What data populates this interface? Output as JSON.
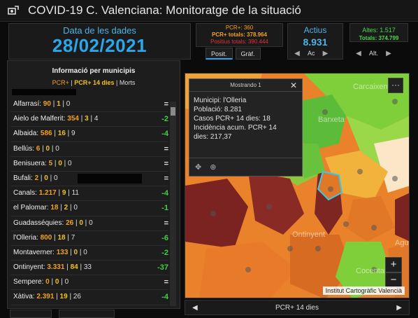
{
  "app": {
    "title": "COVID-19 C. Valenciana: Monitoratge de la situació"
  },
  "date_panel": {
    "label": "Data de les dades",
    "value": "28/02/2021"
  },
  "pcr_panel": {
    "pcr": "PCR+: 360",
    "pcr_totals": "PCR+ totals: 378.964",
    "positius_totals": "Positius totals: 390.444"
  },
  "view_tabs": [
    {
      "label": "Posit."
    },
    {
      "label": "Gràf."
    }
  ],
  "actius": {
    "label": "Actius",
    "value": "8.931",
    "pager_label": "Ac"
  },
  "altes": {
    "line1": "Altes: 1.517",
    "line2": "Totals: 374.799",
    "pager_label": "Alt."
  },
  "municipalities": {
    "title": "Informació per municipis",
    "legend": {
      "a": "PCR+",
      "b": "PCR+ 14 dies",
      "c": "Morts"
    },
    "rows": [
      {
        "name": "Alfarrasí:",
        "pcr": "90",
        "pcr14": "1",
        "morts": "0",
        "change": "="
      },
      {
        "name": "Aielo de Malferit:",
        "pcr": "354",
        "pcr14": "3",
        "morts": "4",
        "change": "-2"
      },
      {
        "name": "Albaida:",
        "pcr": "586",
        "pcr14": "16",
        "morts": "9",
        "change": "-4"
      },
      {
        "name": "Bellús:",
        "pcr": "6",
        "pcr14": "0",
        "morts": "0",
        "change": "="
      },
      {
        "name": "Benisuera:",
        "pcr": "5",
        "pcr14": "0",
        "morts": "0",
        "change": "="
      },
      {
        "name": "Bufali:",
        "pcr": "2",
        "pcr14": "0",
        "morts": "0",
        "change": "="
      },
      {
        "name": "Canals:",
        "pcr": "1.217",
        "pcr14": "9",
        "morts": "11",
        "change": "-4"
      },
      {
        "name": "el Palomar:",
        "pcr": "18",
        "pcr14": "2",
        "morts": "0",
        "change": "-1"
      },
      {
        "name": "Guadasséquies:",
        "pcr": "26",
        "pcr14": "0",
        "morts": "0",
        "change": "="
      },
      {
        "name": "l'Olleria:",
        "pcr": "800",
        "pcr14": "18",
        "morts": "7",
        "change": "-6"
      },
      {
        "name": "Montaverner:",
        "pcr": "133",
        "pcr14": "0",
        "morts": "0",
        "change": "-2"
      },
      {
        "name": "Ontinyent:",
        "pcr": "3.331",
        "pcr14": "84",
        "morts": "33",
        "change": "-37"
      },
      {
        "name": "Sempere:",
        "pcr": "0",
        "pcr14": "0",
        "morts": "0",
        "change": "="
      },
      {
        "name": "Xàtiva:",
        "pcr": "2.391",
        "pcr14": "19",
        "morts": "26",
        "change": "-4"
      }
    ]
  },
  "popup": {
    "header": "Mostrando 1",
    "line1": "Municipi: l'Olleria",
    "line2": "Població: 8.281",
    "line3": "Casos PCR+ 14 dies: 18",
    "line4": "Incidència acum. PCR+ 14",
    "line5": "dies: 217,37"
  },
  "map": {
    "place_labels": [
      "Ontinyent",
      "Cocentaina",
      "Barxeta",
      "Carcaixent",
      "Agu"
    ],
    "attribution": "Institut Cartogràfic Valencià",
    "menu": "···",
    "zoom_in": "+",
    "zoom_out": "−",
    "footer_label": "PCR+ 14 dies"
  },
  "colors": {
    "accent_blue": "#2aa6ea",
    "orange": "#f3a11c",
    "green": "#3fd13f",
    "red": "#d33"
  }
}
